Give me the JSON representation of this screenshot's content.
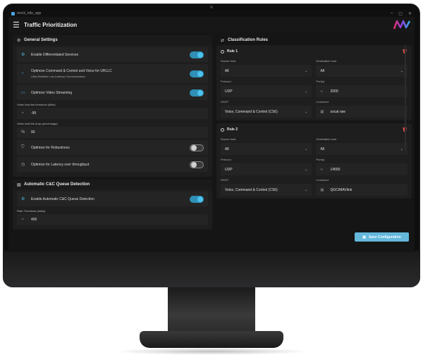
{
  "window": {
    "title": "mock_ride_app",
    "controls": [
      "–",
      "▢",
      "✕"
    ]
  },
  "appbar": {
    "title": "Traffic Prioritization"
  },
  "general": {
    "header": "General Settings",
    "items": [
      {
        "label": "Enable Differentiated Services",
        "on": true
      },
      {
        "label": "Optimize Command & Control and Voice for URLLC",
        "sublabel": "Ultra-Reliable Low-Latency Communication",
        "on": true
      },
      {
        "label": "Optimize Video Streaming",
        "on": true
      }
    ],
    "threshold_label": "Video bad link threshold (dBm)",
    "threshold_value": "-95",
    "drop_label": "Video bad link drop (percentage)",
    "drop_value": "90",
    "robust_label": "Optimize for Robustness",
    "robust_on": false,
    "latency_label": "Optimize for Latency over throughput",
    "latency_on": false
  },
  "queue": {
    "header": "Automatic C&C Queue Detection",
    "enable_label": "Enable Automatic C&C Queue Detection",
    "enable_on": true,
    "rate_label": "Rate Threshold (kbit/s)",
    "rate_value": "400"
  },
  "rules": {
    "header": "Classification Rules",
    "list": [
      {
        "name": "Rule 1",
        "source_host_label": "Source host",
        "source_host": "All",
        "dest_host_label": "Destination host",
        "dest_host": "All",
        "protocol_label": "Protocol",
        "protocol": "UDP",
        "ports_label": "Port(s)",
        "ports": "2000",
        "dscp_label": "DSCP",
        "dscp": "Voice, Command & Control (CS6)",
        "comment_label": "Comment",
        "comment": "socat raw"
      },
      {
        "name": "Rule 2",
        "source_host_label": "Source host",
        "source_host": "All",
        "dest_host_label": "Destination host",
        "dest_host": "All",
        "protocol_label": "Protocol",
        "protocol": "UDP",
        "ports_label": "Port(s)",
        "ports": "14550",
        "dscp_label": "DSCP",
        "dscp": "Voice, Command & Control (CS6)",
        "comment_label": "Comment",
        "comment": "QGC/MAVlink"
      }
    ]
  },
  "save_button": {
    "label": "Save Configuration"
  },
  "colors": {
    "accent": "#4cc2ee",
    "button": "#64b8dc",
    "danger": "#e05050",
    "background": "#151515"
  }
}
